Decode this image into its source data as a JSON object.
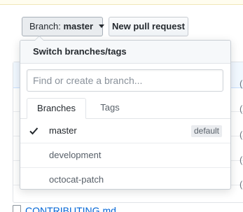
{
  "toolbar": {
    "branch_label": "Branch:",
    "branch_value": "master",
    "new_pr_label": "New pull request"
  },
  "dropdown": {
    "title": "Switch branches/tags",
    "filter": {
      "placeholder": "Find or create a branch...",
      "value": ""
    },
    "tabs": [
      {
        "label": "Branches",
        "selected": true
      },
      {
        "label": "Tags",
        "selected": false
      }
    ],
    "branches": [
      {
        "name": "master",
        "selected": true,
        "badge": "default"
      },
      {
        "name": "development",
        "selected": false
      },
      {
        "name": "octocat-patch",
        "selected": false
      }
    ]
  },
  "background": {
    "file_name": "CONTRIBUTING.md",
    "right_edge_chars": [
      "(",
      "(",
      "(",
      "(",
      "("
    ]
  },
  "colors": {
    "link": "#0366d6",
    "header_bg": "#f6f8fa",
    "badge_bg": "#eaecef"
  }
}
